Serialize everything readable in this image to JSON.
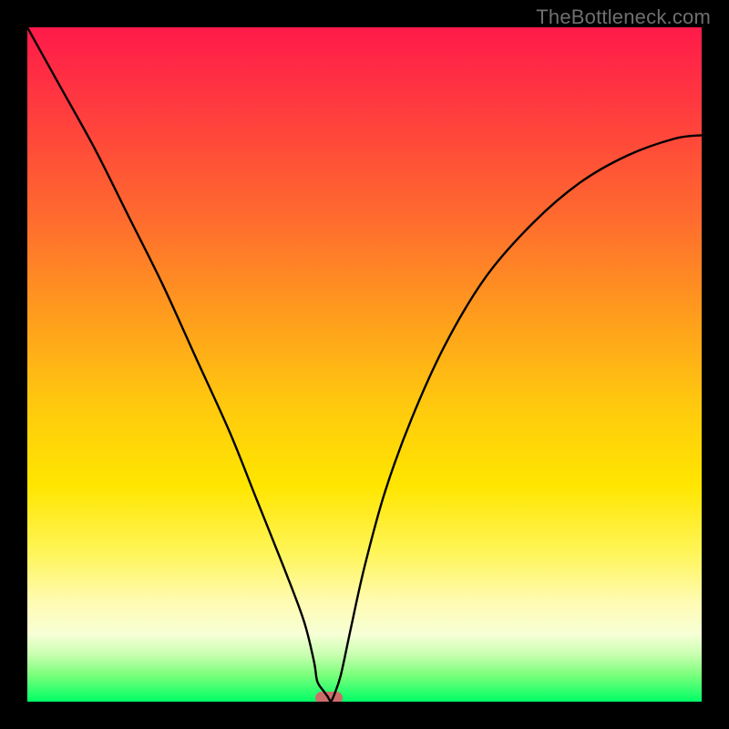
{
  "watermark": "TheBottleneck.com",
  "chart_data": {
    "type": "line",
    "title": "",
    "xlabel": "",
    "ylabel": "",
    "xlim": [
      0,
      1
    ],
    "ylim": [
      0,
      1
    ],
    "series": [
      {
        "name": "curve",
        "x": [
          0.0,
          0.05,
          0.1,
          0.15,
          0.2,
          0.25,
          0.3,
          0.34,
          0.38,
          0.41,
          0.425,
          0.43,
          0.44,
          0.445,
          0.448,
          0.45,
          0.455,
          0.465,
          0.48,
          0.5,
          0.53,
          0.57,
          0.62,
          0.68,
          0.75,
          0.82,
          0.89,
          0.96,
          1.0
        ],
        "y": [
          1.0,
          0.91,
          0.82,
          0.72,
          0.62,
          0.51,
          0.4,
          0.3,
          0.2,
          0.12,
          0.06,
          0.03,
          0.015,
          0.008,
          0.003,
          0.0,
          0.01,
          0.04,
          0.11,
          0.2,
          0.31,
          0.42,
          0.53,
          0.63,
          0.71,
          0.77,
          0.81,
          0.835,
          0.84
        ],
        "color": "#000000"
      }
    ],
    "marker": {
      "x": 0.447,
      "y": 0.0
    },
    "background_gradient": [
      "#ff1a4a",
      "#ff6a2f",
      "#ffc90e",
      "#fff55a",
      "#00ff66"
    ]
  }
}
